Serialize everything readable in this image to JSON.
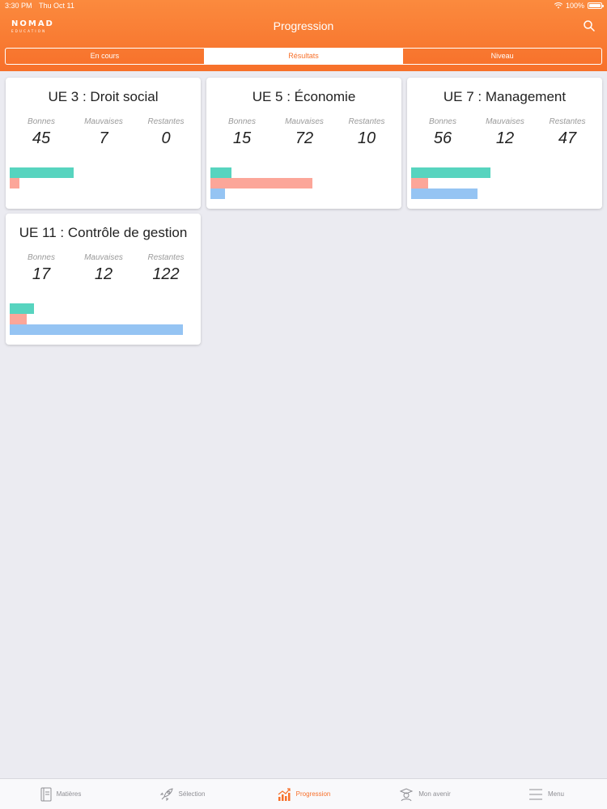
{
  "status_bar": {
    "time": "3:30 PM",
    "date": "Thu Oct 11",
    "battery": "100%"
  },
  "header": {
    "logo_main": "NOMAD",
    "logo_sub": "EDUCATION",
    "title": "Progression",
    "segments": [
      "En cours",
      "Résultats",
      "Niveau"
    ],
    "active_segment": 1
  },
  "stat_labels": {
    "good": "Bonnes",
    "bad": "Mauvaises",
    "left": "Restantes"
  },
  "colors": {
    "accent": "#f7702a",
    "good": "#57d4bf",
    "bad": "#fca699",
    "left": "#95c4f3"
  },
  "cards": [
    {
      "title": "UE 3 : Droit social",
      "good": "45",
      "bad": "7",
      "left": "0"
    },
    {
      "title": "UE 5 : Économie",
      "good": "15",
      "bad": "72",
      "left": "10"
    },
    {
      "title": "UE 7 : Management",
      "good": "56",
      "bad": "12",
      "left": "47"
    },
    {
      "title": "UE 11 : Contrôle de gestion",
      "good": "17",
      "bad": "12",
      "left": "122"
    }
  ],
  "tabbar": {
    "items": [
      {
        "label": "Matières",
        "icon": "book-icon"
      },
      {
        "label": "Sélection",
        "icon": "rocket-icon"
      },
      {
        "label": "Progression",
        "icon": "chart-icon"
      },
      {
        "label": "Mon avenir",
        "icon": "graduate-icon"
      },
      {
        "label": "Menu",
        "icon": "menu-icon"
      }
    ],
    "active": 2
  }
}
